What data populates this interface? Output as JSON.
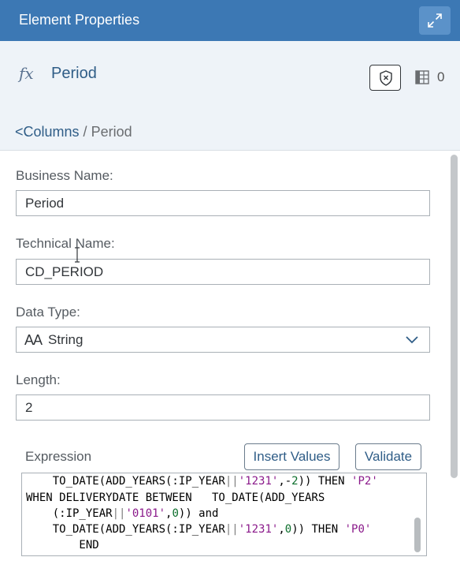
{
  "panel": {
    "title": "Element Properties"
  },
  "header": {
    "icon": "fx-icon",
    "name": "Period",
    "count": "0"
  },
  "breadcrumb": {
    "link": "<Columns",
    "separator": " / ",
    "current": "Period"
  },
  "form": {
    "business_name_label": "Business Name:",
    "business_name_value": "Period",
    "technical_name_label": "Technical Name:",
    "technical_name_value": "CD_PERIOD",
    "data_type_label": "Data Type:",
    "data_type_icon": "AA",
    "data_type_value": "String",
    "length_label": "Length:",
    "length_value": "2"
  },
  "expression": {
    "label": "Expression",
    "insert_values_label": "Insert Values",
    "validate_label": "Validate",
    "lines": [
      "    TO_DATE(ADD_YEARS(:IP_YEAR||'1231',-2)) THEN 'P2'",
      "WHEN DELIVERYDATE BETWEEN   TO_DATE(ADD_YEARS",
      "    (:IP_YEAR||'0101',0)) and",
      "    TO_DATE(ADD_YEARS(:IP_YEAR||'1231',0)) THEN 'P0'",
      "        END"
    ]
  },
  "colors": {
    "titlebar": "#3c78b4",
    "header_bg": "#eef3f8",
    "link": "#2f5d87"
  }
}
